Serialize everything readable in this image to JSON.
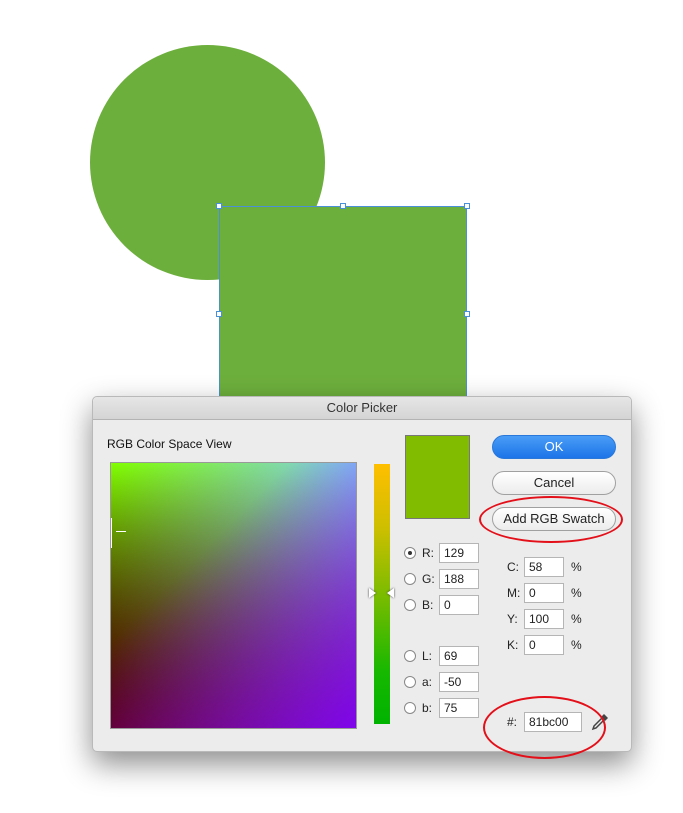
{
  "canvas": {
    "shape_color": "#6daf3d",
    "selection_color": "#4a90d9"
  },
  "dialog": {
    "title": "Color Picker",
    "space_label": "RGB Color Space View",
    "selected_color": "#81bc00",
    "buttons": {
      "ok": "OK",
      "cancel": "Cancel",
      "add_swatch": "Add RGB Swatch"
    },
    "rgb": [
      {
        "label": "R:",
        "value": "129",
        "selected": true
      },
      {
        "label": "G:",
        "value": "188",
        "selected": false
      },
      {
        "label": "B:",
        "value": "0",
        "selected": false
      }
    ],
    "lab": [
      {
        "label": "L:",
        "value": "69"
      },
      {
        "label": "a:",
        "value": "-50"
      },
      {
        "label": "b:",
        "value": "75"
      }
    ],
    "cmyk": [
      {
        "label": "C:",
        "value": "58",
        "unit": "%"
      },
      {
        "label": "M:",
        "value": "0",
        "unit": "%"
      },
      {
        "label": "Y:",
        "value": "100",
        "unit": "%"
      },
      {
        "label": "K:",
        "value": "0",
        "unit": "%"
      }
    ],
    "hex_label": "#:",
    "hex_value": "81bc00",
    "eyedropper_icon": "eyedropper-icon",
    "annotation_color": "#e3101a"
  }
}
